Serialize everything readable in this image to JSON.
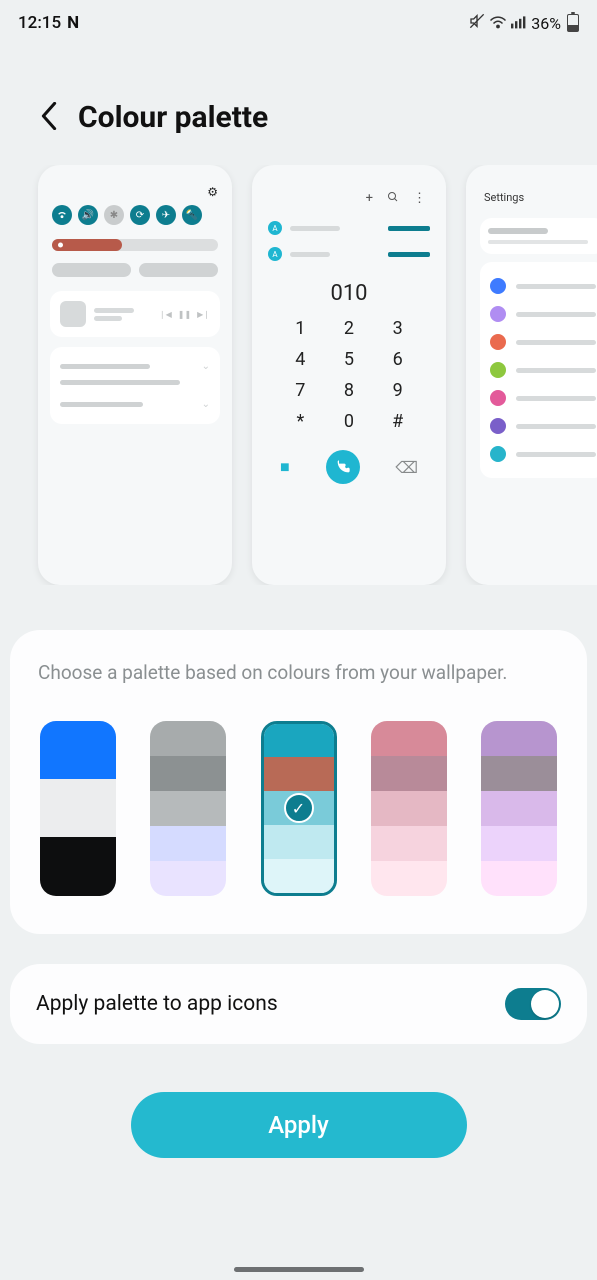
{
  "status": {
    "time": "12:15",
    "app_badge": "N",
    "battery": "36%"
  },
  "header": {
    "title": "Colour palette"
  },
  "previews": {
    "dialer": {
      "number": "010",
      "keys": [
        "1",
        "2",
        "3",
        "4",
        "5",
        "6",
        "7",
        "8",
        "9",
        "*",
        "0",
        "#"
      ],
      "contact_initial": "A"
    },
    "settings": {
      "title": "Settings",
      "row_colors": [
        "#3e7bff",
        "#b08df2",
        "#ea6a4e",
        "#8ec83e",
        "#e35a9a",
        "#7a5fc9",
        "#27b4cb"
      ]
    }
  },
  "palette": {
    "description": "Choose a palette based on colours from your wallpaper.",
    "selected_index": 2,
    "swatches": [
      {
        "type": "coarse",
        "colors": [
          "#1176ff",
          "#ecedee",
          "#0d0e0f"
        ]
      },
      {
        "type": "fine",
        "colors": [
          "#a7abac",
          "#8c9192",
          "#b6babb",
          "#d5dbff",
          "#e9e3ff",
          "#ffd9fb"
        ]
      },
      {
        "type": "fine",
        "colors": [
          "#1aa6bf",
          "#b86a56",
          "#7acbd9",
          "#bfe9f0",
          "#def5f9",
          "#eef0f1"
        ]
      },
      {
        "type": "fine",
        "colors": [
          "#d78a99",
          "#b88a99",
          "#e5b8c4",
          "#f6d3de",
          "#ffe6ee",
          "#ffdcb0"
        ]
      },
      {
        "type": "fine",
        "colors": [
          "#b795cf",
          "#9b8e99",
          "#d9b9ea",
          "#ecd3fb",
          "#ffe1fb",
          "#ffd9d4"
        ]
      }
    ]
  },
  "toggle": {
    "label": "Apply palette to app icons",
    "on": true
  },
  "apply": {
    "label": "Apply"
  }
}
